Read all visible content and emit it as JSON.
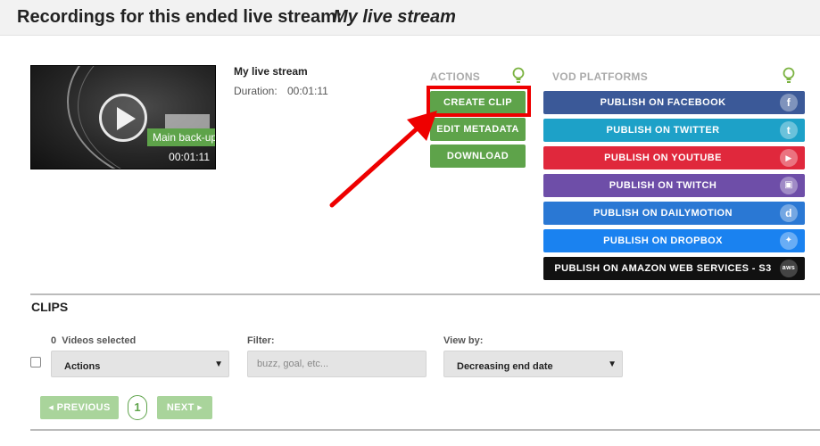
{
  "header": {
    "title": "Recordings for this ended live stream:",
    "stream_name": "My live stream"
  },
  "video": {
    "title": "My live stream",
    "duration_label": "Duration:",
    "duration_value": "00:01:11",
    "thumb_duration": "00:01:11",
    "badge": "Main back-up"
  },
  "actions": {
    "label": "ACTIONS",
    "create_clip": "CREATE CLIP",
    "edit_metadata": "EDIT METADATA",
    "download": "DOWNLOAD"
  },
  "vod": {
    "label": "VOD PLATFORMS",
    "buttons": [
      {
        "label": "PUBLISH ON FACEBOOK",
        "icon": "facebook-icon",
        "glyph": "f",
        "color": "#3b5998"
      },
      {
        "label": "PUBLISH ON TWITTER",
        "icon": "twitter-icon",
        "glyph": "t",
        "color": "#1da1c8"
      },
      {
        "label": "PUBLISH ON YOUTUBE",
        "icon": "youtube-icon",
        "glyph": "▶",
        "color": "#e0283c"
      },
      {
        "label": "PUBLISH ON TWITCH",
        "icon": "twitch-icon",
        "glyph": "▣",
        "color": "#6e4ea8"
      },
      {
        "label": "PUBLISH ON DAILYMOTION",
        "icon": "dailymotion-icon",
        "glyph": "d",
        "color": "#2a78d4"
      },
      {
        "label": "PUBLISH ON DROPBOX",
        "icon": "dropbox-icon",
        "glyph": "✦",
        "color": "#1a82f0"
      },
      {
        "label": "PUBLISH ON AMAZON WEB SERVICES - S3",
        "icon": "aws-icon",
        "glyph": "aws",
        "color": "#111111"
      }
    ]
  },
  "clips": {
    "title": "CLIPS",
    "selected_count": "0",
    "selected_label": "Videos selected",
    "actions_select": "Actions",
    "filter_label": "Filter:",
    "filter_placeholder": "buzz, goal, etc...",
    "viewby_label": "View by:",
    "viewby_select": "Decreasing end date"
  },
  "pagination": {
    "previous": "PREVIOUS",
    "page": "1",
    "next": "NEXT"
  },
  "colors": {
    "accent_green": "#5ea34a",
    "highlight_red": "#e00000"
  }
}
